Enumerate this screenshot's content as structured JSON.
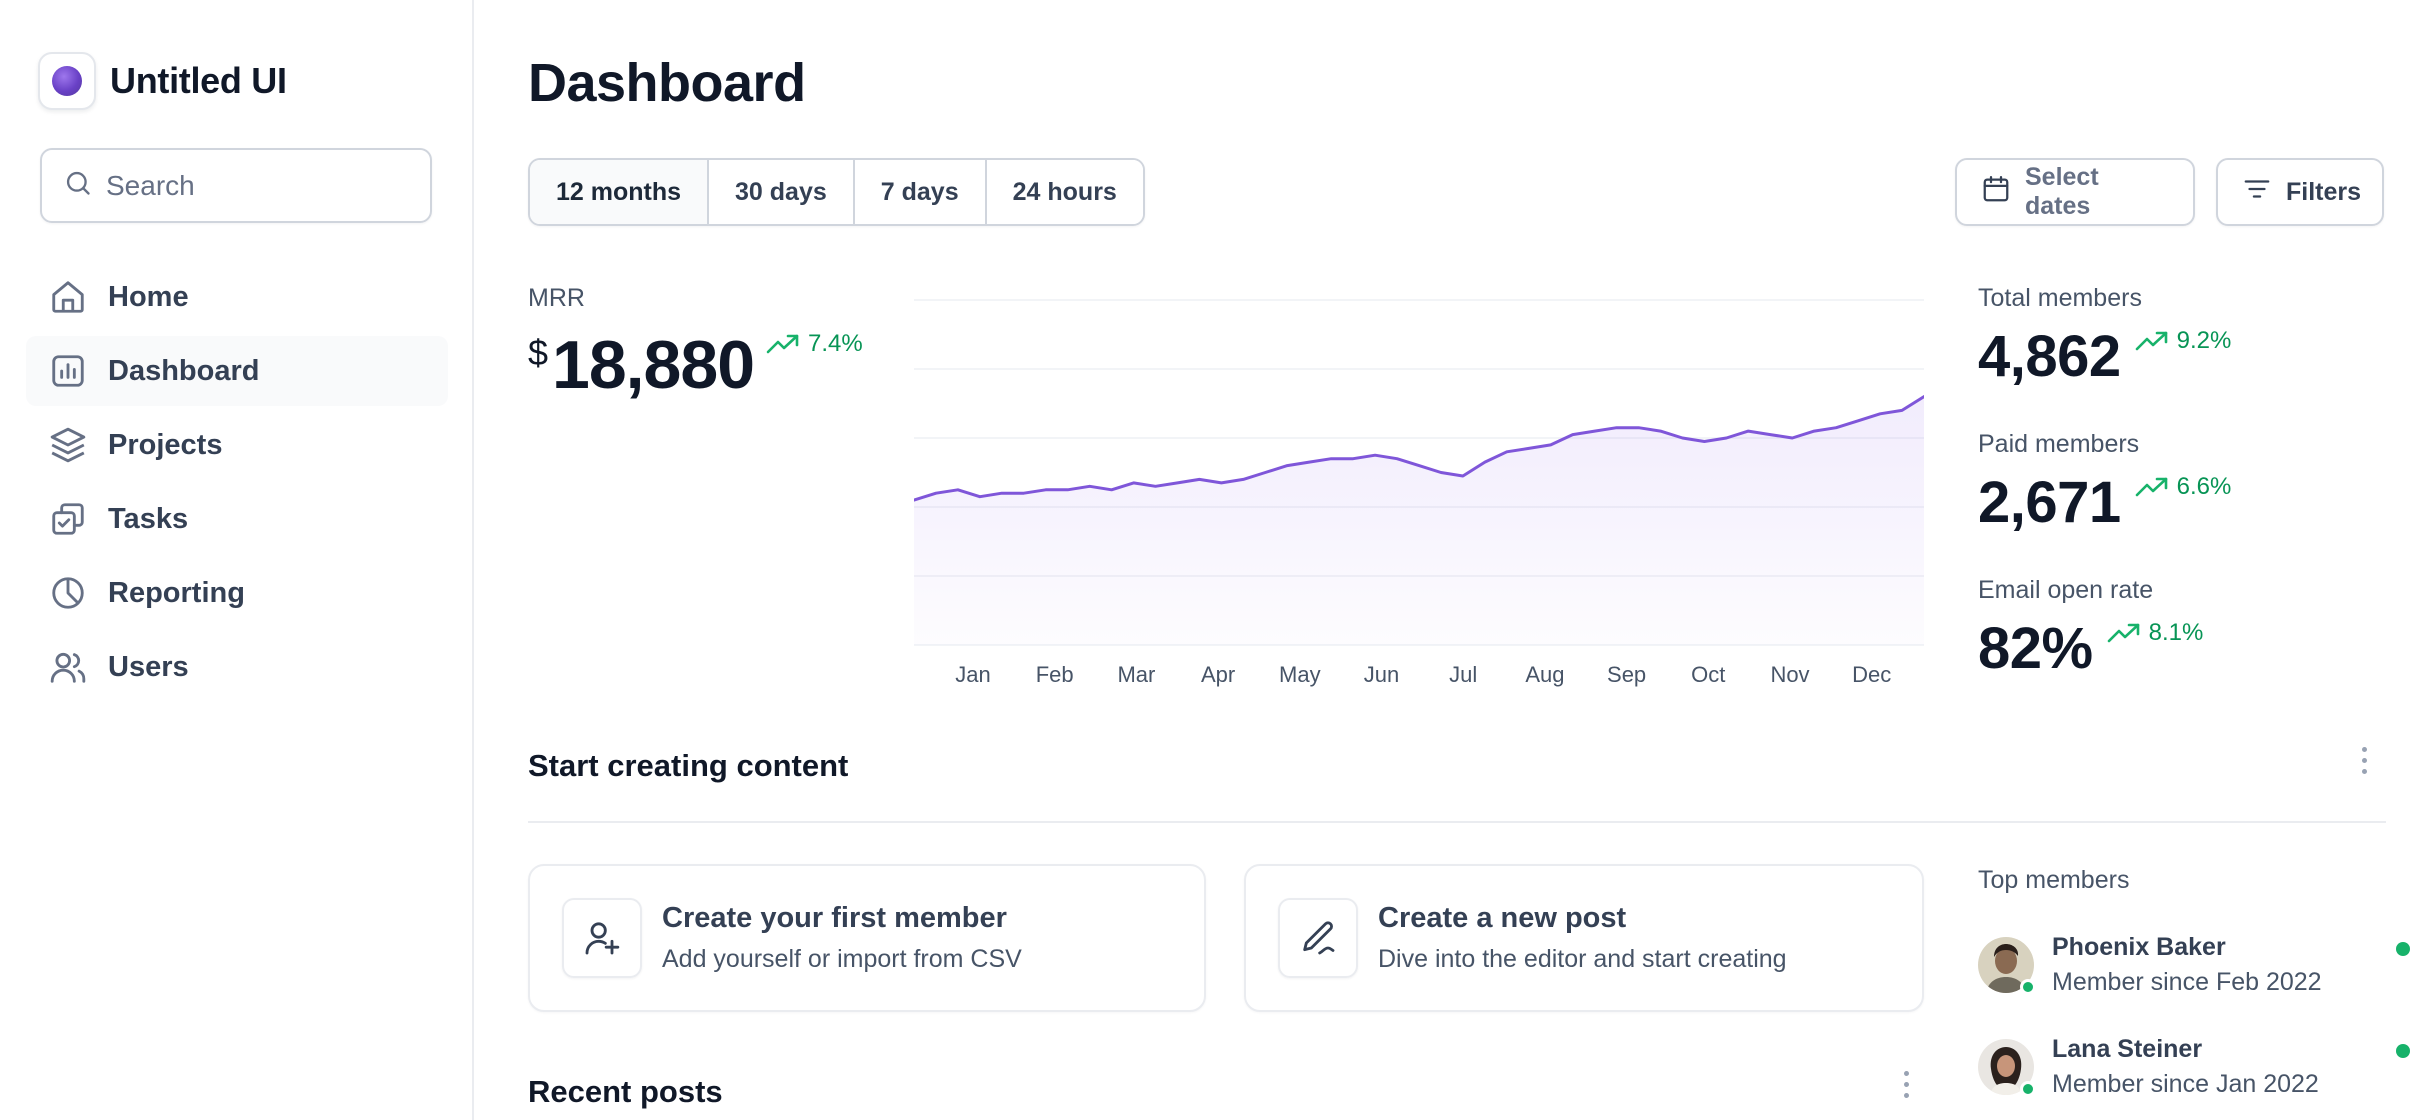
{
  "sidebar": {
    "brand": "Untitled UI",
    "search_placeholder": "Search",
    "items": [
      {
        "label": "Home",
        "icon": "home-icon"
      },
      {
        "label": "Dashboard",
        "icon": "bar-chart-icon"
      },
      {
        "label": "Projects",
        "icon": "layers-icon"
      },
      {
        "label": "Tasks",
        "icon": "check-square-icon"
      },
      {
        "label": "Reporting",
        "icon": "pie-chart-icon"
      },
      {
        "label": "Users",
        "icon": "users-icon"
      }
    ],
    "active_item": "Dashboard"
  },
  "header": {
    "title": "Dashboard",
    "ranges": [
      "12 months",
      "30 days",
      "7 days",
      "24 hours"
    ],
    "active_range": "12 months",
    "select_dates_label": "Select dates",
    "filters_label": "Filters"
  },
  "mrr": {
    "label": "MRR",
    "currency": "$",
    "value": "18,880",
    "change": "7.4%"
  },
  "stats": [
    {
      "label": "Total members",
      "value": "4,862",
      "change": "9.2%"
    },
    {
      "label": "Paid members",
      "value": "2,671",
      "change": "6.6%"
    },
    {
      "label": "Email open rate",
      "value": "82%",
      "change": "8.1%"
    }
  ],
  "colors": {
    "accent": "#7f56d9",
    "positive": "#079455",
    "online": "#17b26a"
  },
  "chart_data": {
    "type": "area",
    "categories": [
      "Jan",
      "Feb",
      "Mar",
      "Apr",
      "May",
      "Jun",
      "Jul",
      "Aug",
      "Sep",
      "Oct",
      "Nov",
      "Dec"
    ],
    "grid": true,
    "ylim": [
      0,
      100
    ],
    "series": [
      {
        "values": [
          42,
          44,
          45,
          43,
          44,
          44,
          45,
          45,
          46,
          45,
          47,
          46,
          47,
          48,
          47,
          48,
          50,
          52,
          53,
          54,
          54,
          55,
          54,
          52,
          50,
          49,
          53,
          56,
          57,
          58,
          61,
          62,
          63,
          63,
          62,
          60,
          59,
          60,
          62,
          61,
          60,
          62,
          63,
          65,
          67,
          68,
          72
        ]
      }
    ]
  },
  "content": {
    "title": "Start creating content",
    "cards": [
      {
        "title": "Create your first member",
        "subtitle": "Add yourself or import from CSV",
        "icon": "user-plus-icon"
      },
      {
        "title": "Create a new post",
        "subtitle": "Dive into the editor and start creating",
        "icon": "pen-icon"
      }
    ],
    "recent_title": "Recent posts"
  },
  "top_members": {
    "title": "Top members",
    "members": [
      {
        "name": "Phoenix Baker",
        "since": "Member since Feb 2022"
      },
      {
        "name": "Lana Steiner",
        "since": "Member since Jan 2022"
      }
    ]
  }
}
